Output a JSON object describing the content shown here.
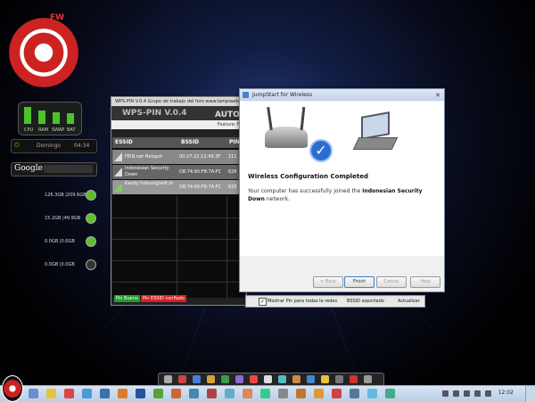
{
  "logo": {
    "text": "FW"
  },
  "meter": {
    "labels": [
      "CPU",
      "RAM",
      "SWAP",
      "BAT"
    ],
    "levels": [
      0.85,
      0.7,
      0.6,
      0.55
    ]
  },
  "clock_gadget": {
    "left": "Domingo",
    "right": "04:34"
  },
  "search": {
    "brand": "Google"
  },
  "drives": [
    {
      "text": "126.3GB  |209.6GB"
    },
    {
      "text": "15.2GB  |49.9GB"
    },
    {
      "text": "0.0GB  |0.0GB"
    },
    {
      "text": "0.0GB  |0.0GB"
    }
  ],
  "wps": {
    "title": "WPS-PIN V.0.4  Grupo de trabajo del foro www.lampiweb.com",
    "banner": "WPS-PIN V.0.4",
    "banner_right": "AUTO",
    "feature": "Feature: F7",
    "columns": [
      "ESSID",
      "BSSID",
      "PIN"
    ],
    "rows": [
      {
        "essid": "FEIN.net Hotspot",
        "bssid": "00:27:22:12:49:3F",
        "pin": "111"
      },
      {
        "essid": "Indonesian Security Down",
        "bssid": "D8:74:95:F8:7A:FC",
        "pin": "628"
      },
      {
        "essid": "Kandy hidrasi@wifi.id",
        "bssid": "D8:74:95:F8:7A:FC",
        "pin": "628"
      }
    ],
    "status_good": "Pin Bueno",
    "status_bad": "Pin ESSID confiado"
  },
  "bottom_strip": {
    "checkbox": "Mostrar Pin para todas la redes",
    "middle": "BSSID soportado",
    "right": "Actualizar"
  },
  "dialog": {
    "title": "JumpStart for Wireless",
    "heading": "Wireless Configuration Completed",
    "message_prefix": "Your computer has successfully joined the ",
    "network": "Indonesian Security Down",
    "message_suffix": " network.",
    "buttons": {
      "back": "< Back",
      "finish": "Finish",
      "cancel": "Cancel",
      "help": "Help"
    }
  },
  "taskbar": {
    "clock": "12:02"
  }
}
